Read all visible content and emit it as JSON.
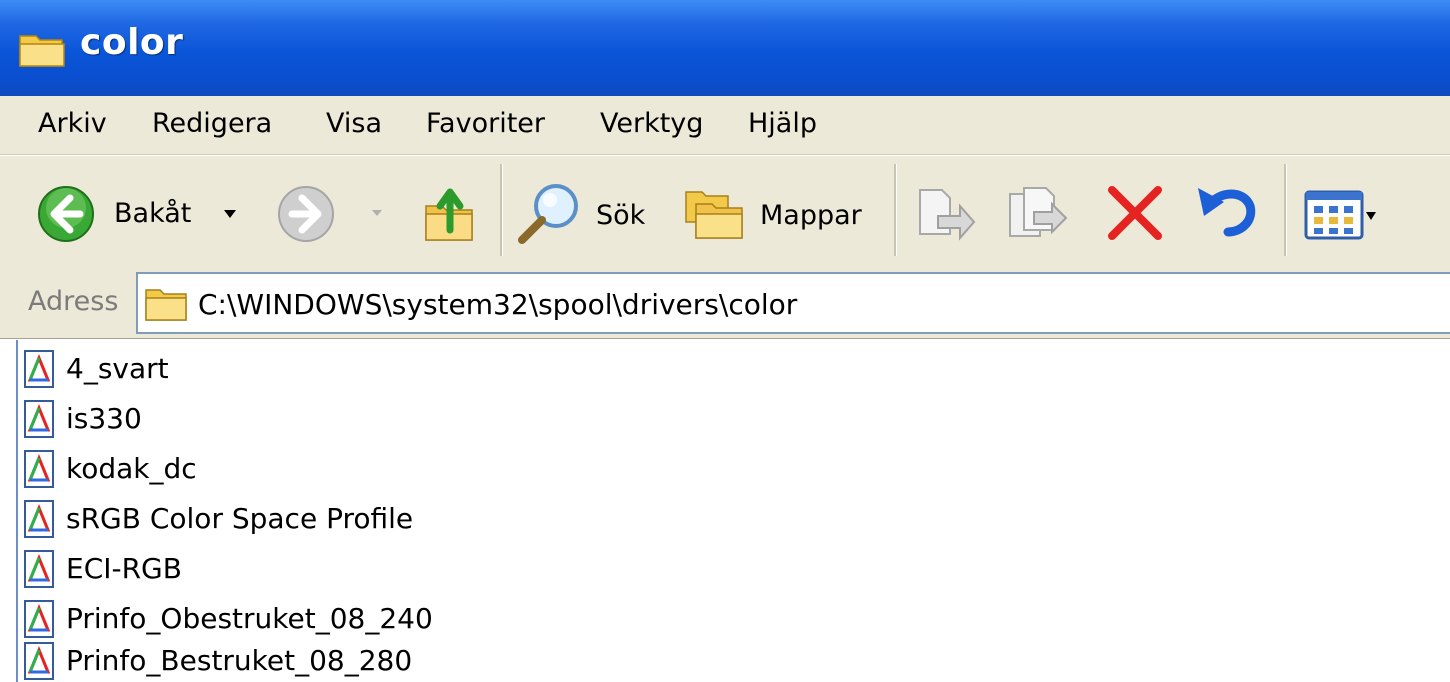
{
  "window": {
    "title": "color"
  },
  "menu": [
    "Arkiv",
    "Redigera",
    "Visa",
    "Favoriter",
    "Verktyg",
    "Hjälp"
  ],
  "toolbar": {
    "back_label": "Bakåt",
    "search_label": "Sök",
    "folders_label": "Mappar",
    "icons": [
      "back-arrow-icon",
      "dropdown-arrow-icon",
      "forward-arrow-icon",
      "folder-up-icon",
      "search-magnifier-icon",
      "folders-icon",
      "move-to-icon",
      "copy-to-icon",
      "delete-x-icon",
      "undo-icon",
      "views-icon"
    ]
  },
  "address": {
    "label": "Adress",
    "path": "C:\\WINDOWS\\system32\\spool\\drivers\\color"
  },
  "files": [
    "4_svart",
    "is330",
    "kodak_dc",
    "sRGB Color Space Profile",
    "ECI-RGB",
    "Prinfo_Obestruket_08_240",
    "Prinfo_Bestruket_08_280"
  ],
  "colors": {
    "titlebar": "#0a55d8",
    "chrome": "#ece9d8",
    "delete_red": "#e52421",
    "undo_blue": "#1d5fd6"
  }
}
